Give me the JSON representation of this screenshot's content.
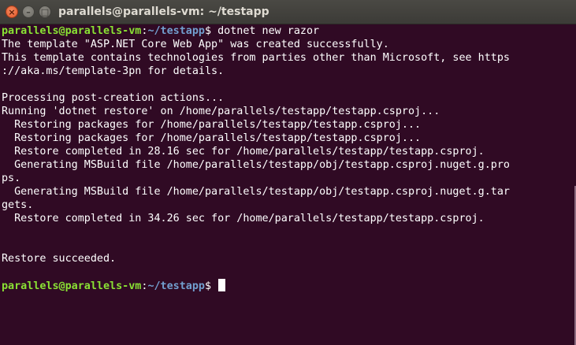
{
  "window": {
    "title": "parallels@parallels-vm: ~/testapp",
    "close_glyph": "×",
    "minimize_glyph": "–",
    "maximize_glyph": "□"
  },
  "terminal": {
    "prompt": {
      "user_host": "parallels@parallels-vm",
      "separator": ":",
      "path": "~/testapp",
      "symbol": "$ "
    },
    "command": "dotnet new razor",
    "output": [
      "The template \"ASP.NET Core Web App\" was created successfully.",
      "This template contains technologies from parties other than Microsoft, see https",
      "://aka.ms/template-3pn for details.",
      "",
      "Processing post-creation actions...",
      "Running 'dotnet restore' on /home/parallels/testapp/testapp.csproj...",
      "  Restoring packages for /home/parallels/testapp/testapp.csproj...",
      "  Restoring packages for /home/parallels/testapp/testapp.csproj...",
      "  Restore completed in 28.16 sec for /home/parallels/testapp/testapp.csproj.",
      "  Generating MSBuild file /home/parallels/testapp/obj/testapp.csproj.nuget.g.pro",
      "ps.",
      "  Generating MSBuild file /home/parallels/testapp/obj/testapp.csproj.nuget.g.tar",
      "gets.",
      "  Restore completed in 34.26 sec for /home/parallels/testapp/testapp.csproj.",
      "",
      "",
      "Restore succeeded.",
      ""
    ],
    "colors": {
      "background": "#300a24",
      "foreground": "#ffffff",
      "user_host": "#8ae234",
      "path": "#729fcf"
    }
  }
}
